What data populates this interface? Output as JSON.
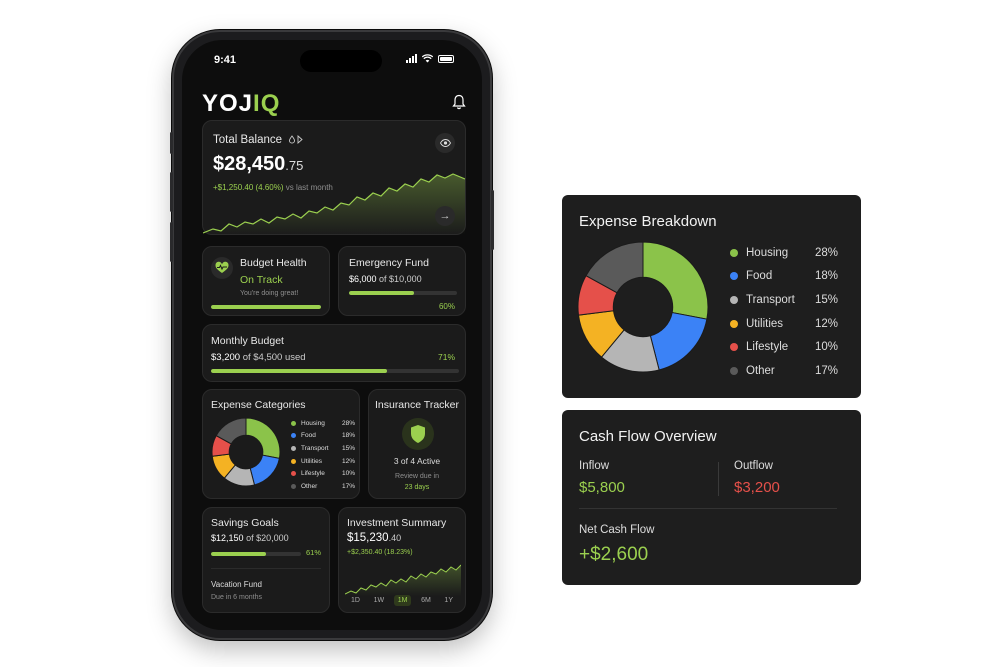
{
  "status": {
    "time": "9:41"
  },
  "app": {
    "logo_main": "YOJ",
    "logo_accent": "IQ"
  },
  "balance": {
    "title": "Total Balance",
    "amount_main": "$28,450",
    "amount_cents": ".75",
    "change": "+$1,250.40 (4.60%)",
    "change_suffix": "vs last month"
  },
  "budget_health": {
    "title": "Budget Health",
    "status": "On Track",
    "subtitle": "You're doing great!",
    "progress": 1.0
  },
  "emergency_fund": {
    "title": "Emergency Fund",
    "amount": "$6,000",
    "of_text": "of $10,000",
    "percent": "60%",
    "progress": 0.6
  },
  "monthly_budget": {
    "title": "Monthly Budget",
    "amount": "$3,200",
    "of_text": "of $4,500 used",
    "percent": "71%",
    "progress": 0.71
  },
  "expense_categories": {
    "title": "Expense Categories",
    "items": [
      {
        "name": "Housing",
        "percent": "28%",
        "value": 28,
        "color": "#8bc34a"
      },
      {
        "name": "Food",
        "percent": "18%",
        "value": 18,
        "color": "#3b82f6"
      },
      {
        "name": "Transport",
        "percent": "15%",
        "value": 15,
        "color": "#b5b5b5"
      },
      {
        "name": "Utilities",
        "percent": "12%",
        "value": 12,
        "color": "#f4b223"
      },
      {
        "name": "Lifestyle",
        "percent": "10%",
        "value": 10,
        "color": "#e5504a"
      },
      {
        "name": "Other",
        "percent": "17%",
        "value": 17,
        "color": "#5a5a5a"
      }
    ]
  },
  "insurance": {
    "title": "Insurance Tracker",
    "active": "3 of 4 Active",
    "review": "Review due in",
    "days": "23 days"
  },
  "savings": {
    "title": "Savings Goals",
    "amount": "$12,150",
    "of_text": "of $20,000",
    "percent": "61%",
    "progress": 0.61,
    "goal_name": "Vacation Fund",
    "goal_due": "Due in 6 months"
  },
  "investment": {
    "title": "Investment Summary",
    "amount_main": "$15,230",
    "amount_cents": ".40",
    "change": "+$2,350.40 (18.23%)",
    "timeframes": [
      "1D",
      "1W",
      "1M",
      "6M",
      "1Y"
    ],
    "active_timeframe": "1M"
  },
  "expense_breakdown": {
    "title": "Expense Breakdown"
  },
  "cash_flow": {
    "title": "Cash Flow Overview",
    "inflow_label": "Inflow",
    "inflow": "$5,800",
    "outflow_label": "Outflow",
    "outflow": "$3,200",
    "net_label": "Net Cash Flow",
    "net": "+$2,600"
  },
  "colors": {
    "accent": "#9bd04f",
    "negative": "#e5504a",
    "card": "#1b1b1b"
  }
}
